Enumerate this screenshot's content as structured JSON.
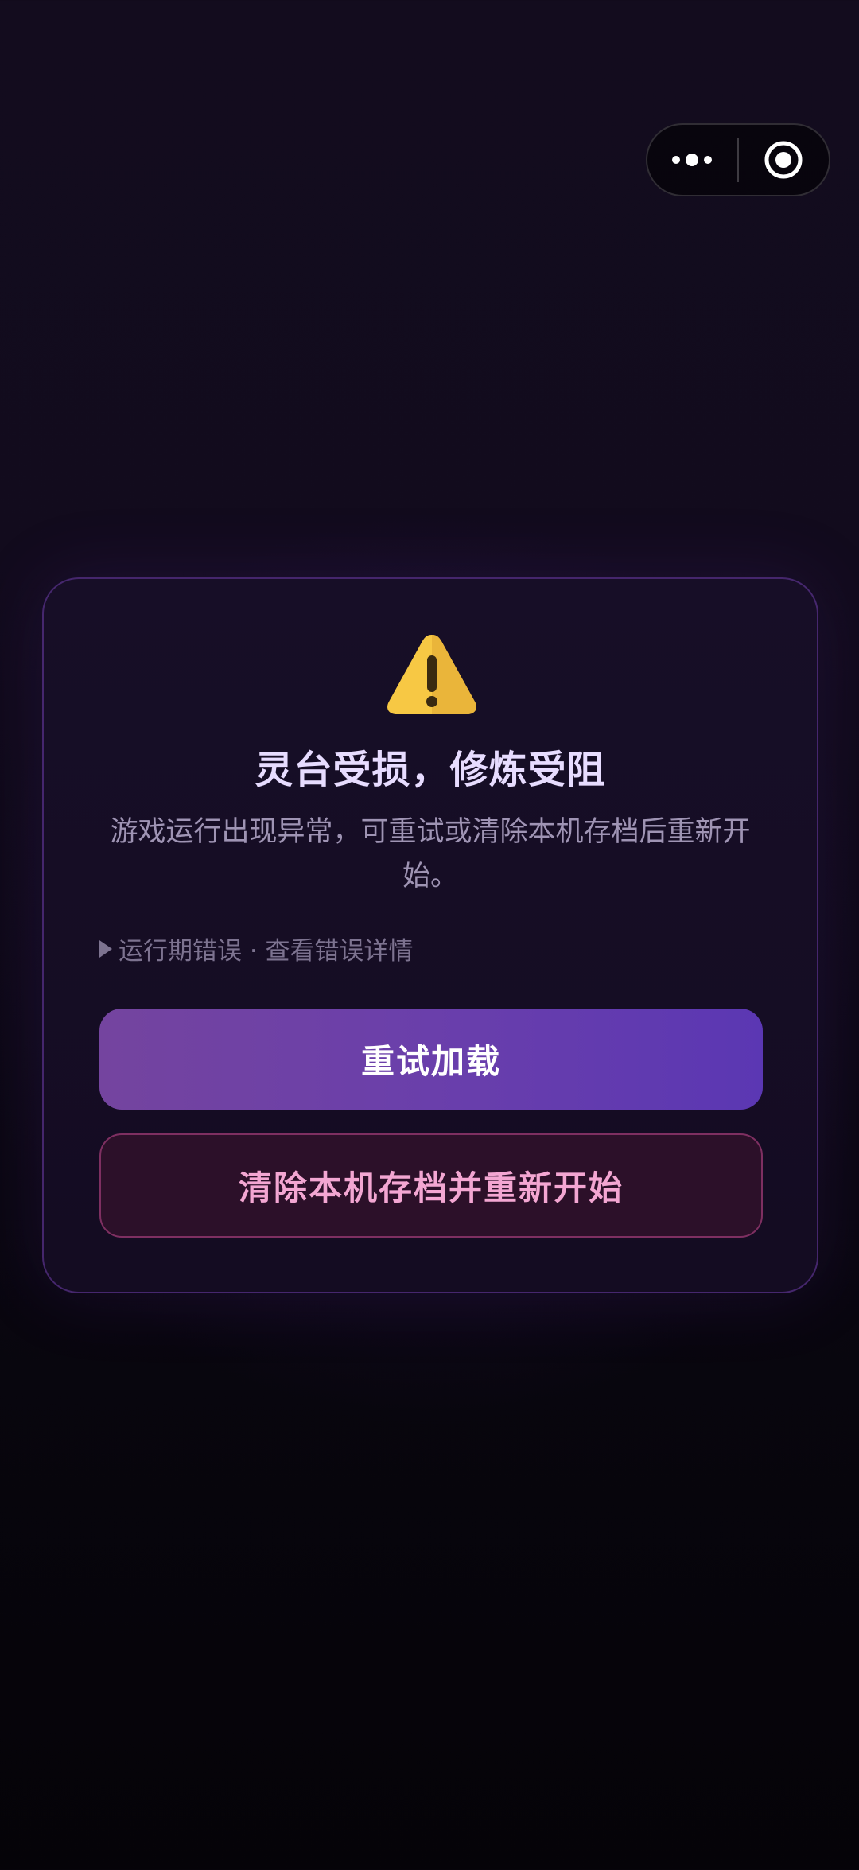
{
  "capsule": {
    "menu_icon": "more-dots-icon",
    "close_icon": "target-circle-icon"
  },
  "error_card": {
    "icon": "warning-icon",
    "title": "灵台受损，修炼受阻",
    "description": "游戏运行出现异常，可重试或清除本机存档后重新开始。",
    "details_toggle": "运行期错误 · 查看错误详情",
    "retry_label": "重试加载",
    "reset_label": "清除本机存档并重新开始"
  },
  "colors": {
    "accent_purple": "#6a3fab",
    "danger_pink": "#f3a6d2",
    "warning_yellow": "#f7c844"
  }
}
